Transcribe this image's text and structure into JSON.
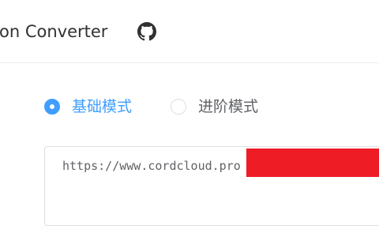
{
  "header": {
    "title": "on Converter",
    "github_icon": "github-icon"
  },
  "mode": {
    "options": [
      {
        "label": "基础模式",
        "checked": true
      },
      {
        "label": "进阶模式",
        "checked": false
      }
    ]
  },
  "subscription": {
    "value": "https://www.cordcloud.pro"
  },
  "colors": {
    "accent": "#409eff",
    "redaction": "#ee1c25",
    "border": "#dcdfe6"
  }
}
